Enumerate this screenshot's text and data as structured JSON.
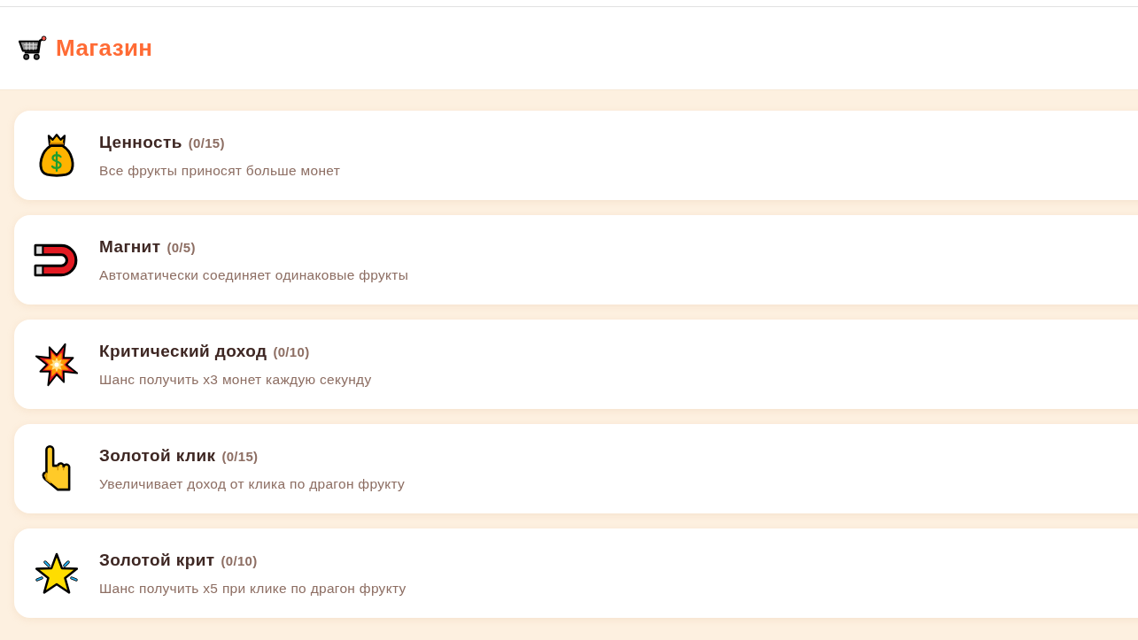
{
  "header": {
    "title": "Магазин"
  },
  "upgrades": [
    {
      "name": "Ценность",
      "count": "(0/15)",
      "description": "Все фрукты приносят больше монет"
    },
    {
      "name": "Магнит",
      "count": "(0/5)",
      "description": "Автоматически соединяет одинаковые фрукты"
    },
    {
      "name": "Критический доход",
      "count": "(0/10)",
      "description": "Шанс получить x3 монет каждую секунду"
    },
    {
      "name": "Золотой клик",
      "count": "(0/15)",
      "description": "Увеличивает доход от клика по драгон фрукту"
    },
    {
      "name": "Золотой крит",
      "count": "(0/10)",
      "description": "Шанс получить x5 при клике по драгон фрукту"
    }
  ]
}
